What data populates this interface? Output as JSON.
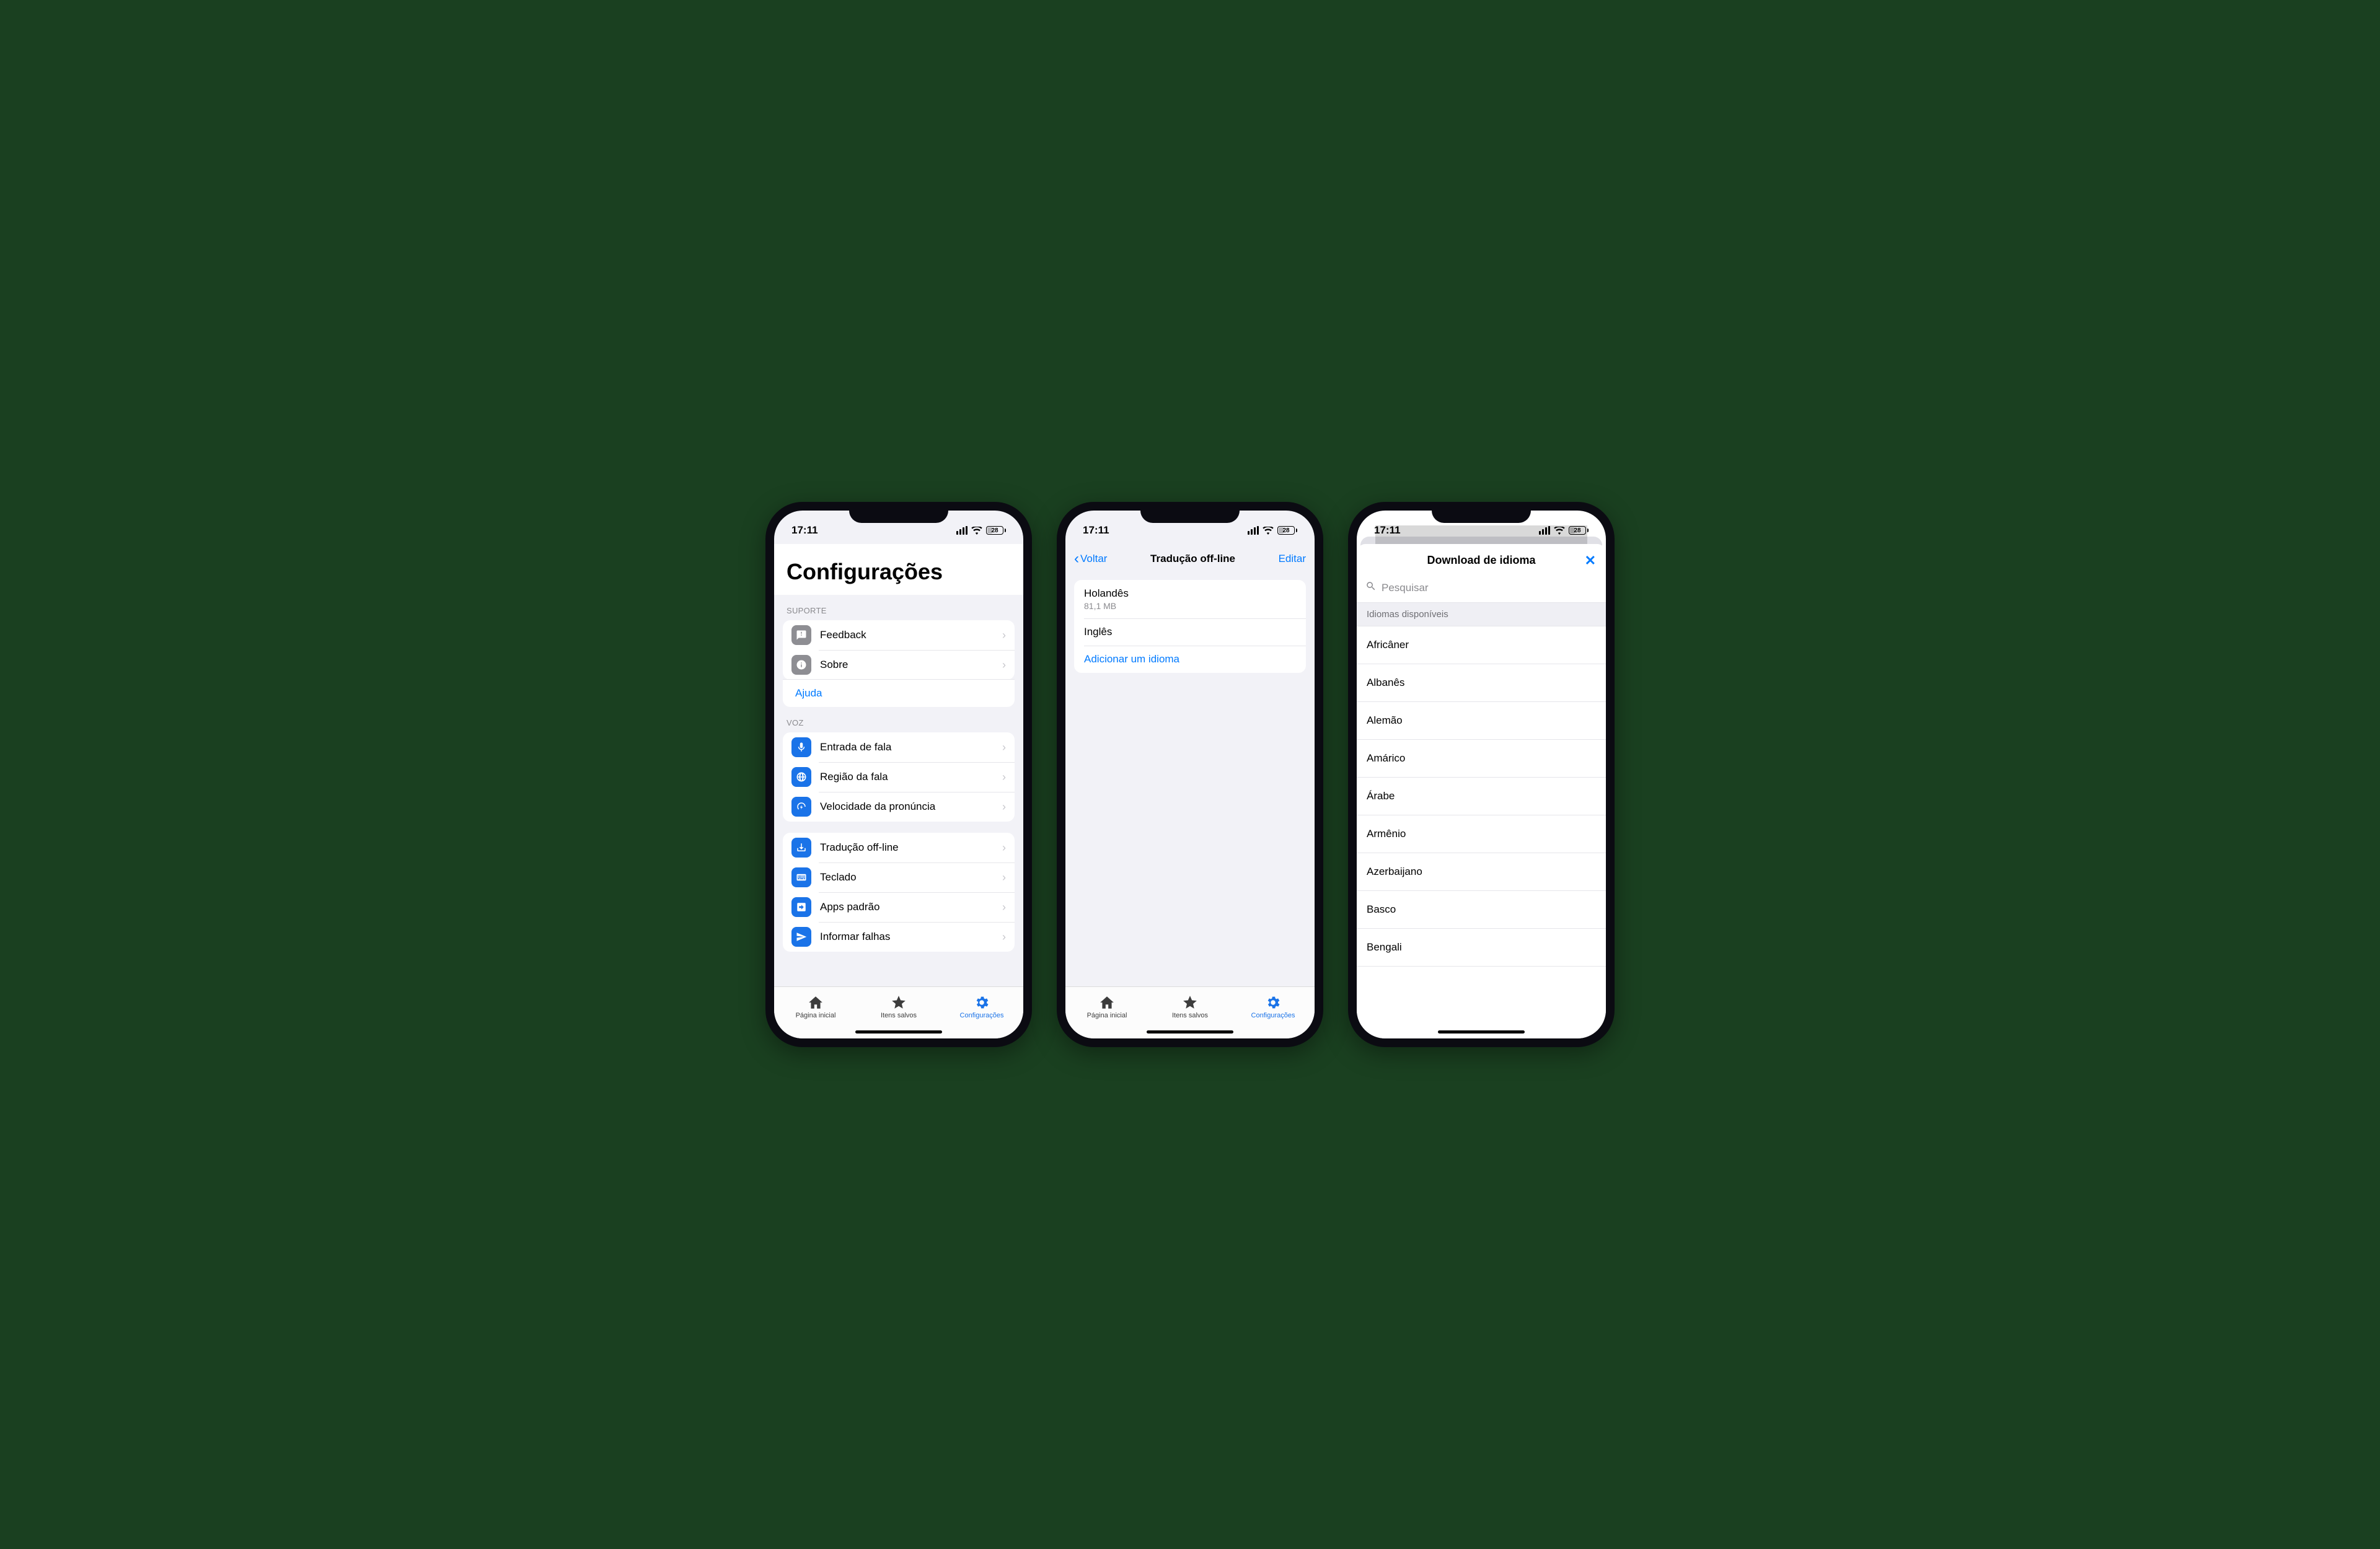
{
  "status": {
    "time": "17:11",
    "battery": "28"
  },
  "screen1": {
    "title": "Configurações",
    "suporte_header": "SUPORTE",
    "feedback": "Feedback",
    "sobre": "Sobre",
    "ajuda": "Ajuda",
    "voz_header": "VOZ",
    "entrada_fala": "Entrada de fala",
    "regiao_fala": "Região da fala",
    "velocidade": "Velocidade da pronúncia",
    "traducao_offline": "Tradução off-line",
    "teclado": "Teclado",
    "apps_padrao": "Apps padrão",
    "informar_falhas": "Informar falhas"
  },
  "tabbar": {
    "home": "Página inicial",
    "saved": "Itens salvos",
    "settings": "Configurações"
  },
  "screen2": {
    "back": "Voltar",
    "title": "Tradução off-line",
    "edit": "Editar",
    "lang1_name": "Holandês",
    "lang1_size": "81,1 MB",
    "lang2_name": "Inglês",
    "add": "Adicionar um idioma"
  },
  "screen3": {
    "title": "Download de idioma",
    "search_placeholder": "Pesquisar",
    "available_header": "Idiomas disponíveis",
    "langs": [
      "Africâner",
      "Albanês",
      "Alemão",
      "Amárico",
      "Árabe",
      "Armênio",
      "Azerbaijano",
      "Basco",
      "Bengali"
    ]
  }
}
